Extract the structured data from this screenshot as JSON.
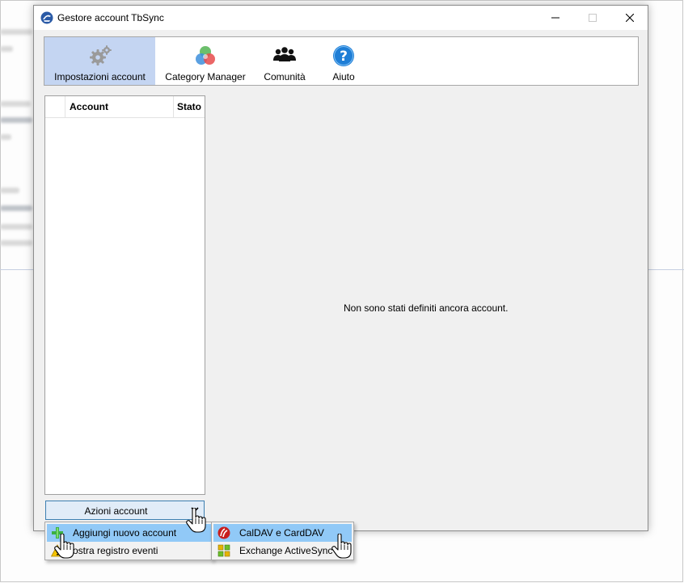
{
  "window": {
    "title": "Gestore account TbSync"
  },
  "toolbar": {
    "items": [
      {
        "label": "Impostazioni account",
        "icon": "gears-icon",
        "active": true
      },
      {
        "label": "Category Manager",
        "icon": "color-circles-icon",
        "active": false
      },
      {
        "label": "Comunità",
        "icon": "people-icon",
        "active": false
      },
      {
        "label": "Aiuto",
        "icon": "help-icon",
        "active": false
      }
    ]
  },
  "account_list": {
    "columns": [
      "Account",
      "Stato"
    ],
    "rows": []
  },
  "main": {
    "empty_message": "Non sono stati definiti ancora account."
  },
  "actions_button": {
    "label": "Azioni account"
  },
  "actions_menu": {
    "items": [
      {
        "label": "Aggiungi nuovo account",
        "icon": "plus-icon",
        "highlighted": true
      },
      {
        "label": "ostra registro eventi",
        "icon": "warning-icon",
        "highlighted": false
      }
    ]
  },
  "submenu": {
    "items": [
      {
        "label": "CalDAV e CardDAV",
        "icon": "caldav-icon",
        "highlighted": true
      },
      {
        "label": "Exchange ActiveSync",
        "icon": "activesync-icon",
        "highlighted": false
      }
    ]
  },
  "colors": {
    "toolbar_active": "#c4d5f2",
    "menu_highlight": "#91c9f7",
    "button_bg": "#e1ecf8",
    "button_border": "#3c7fb1"
  }
}
